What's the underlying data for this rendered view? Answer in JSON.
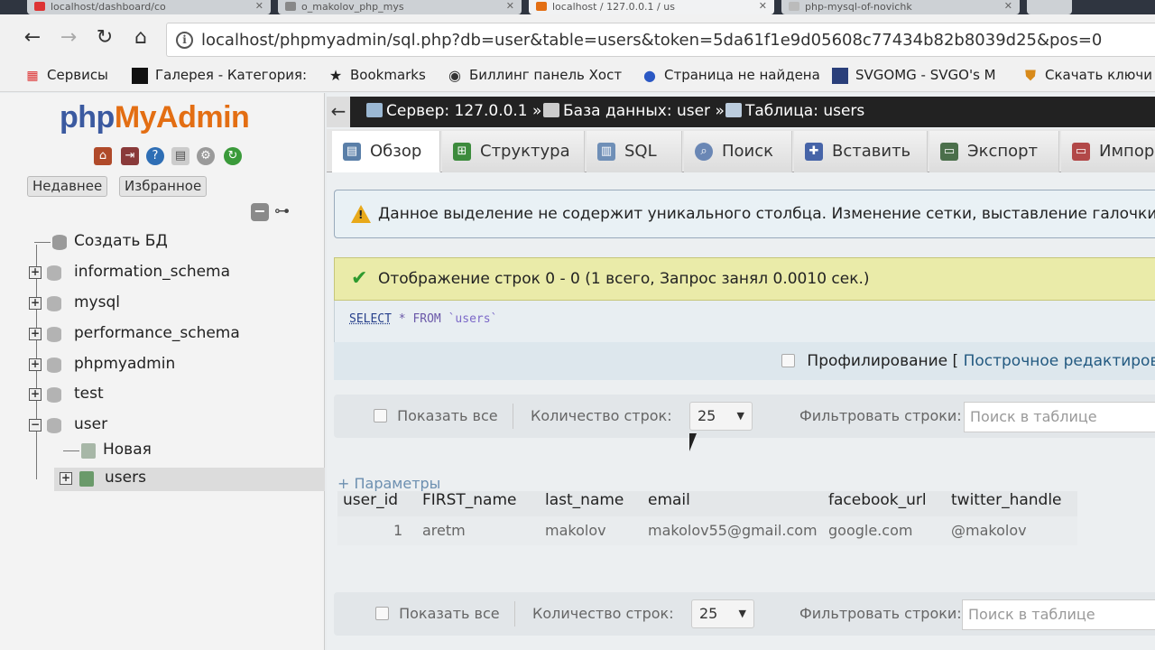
{
  "browser": {
    "tabs": [
      {
        "label": "localhost/dashboard/co",
        "active": false
      },
      {
        "label": "o_makolov_php_mys",
        "active": false
      },
      {
        "label": "localhost / 127.0.0.1 / us",
        "active": true
      },
      {
        "label": "php-mysql-of-novichk",
        "active": false
      }
    ],
    "url": "localhost/phpmyadmin/sql.php?db=user&table=users&token=5da61f1e9d05608c77434b82b8039d25&pos=0",
    "bookmarks": [
      {
        "label": "Сервисы",
        "icon": "apps-grid-icon"
      },
      {
        "label": "Галерея - Категория:",
        "icon": "gallery-icon"
      },
      {
        "label": "Bookmarks",
        "icon": "star-icon"
      },
      {
        "label": "Биллинг панель Хост",
        "icon": "billing-icon"
      },
      {
        "label": "Страница не найдена",
        "icon": "location-pin-icon"
      },
      {
        "label": "SVGOMG - SVGO's M",
        "icon": "svgomg-icon"
      },
      {
        "label": "Скачать ключи д",
        "icon": "shield-icon"
      }
    ]
  },
  "sidebar": {
    "logo": {
      "php": "php",
      "my": "My",
      "admin": "Admin"
    },
    "recent_label": "Недавнее",
    "favorites_label": "Избранное",
    "tree": [
      {
        "label": "Создать БД",
        "type": "new"
      },
      {
        "label": "information_schema",
        "type": "db"
      },
      {
        "label": "mysql",
        "type": "db"
      },
      {
        "label": "performance_schema",
        "type": "db"
      },
      {
        "label": "phpmyadmin",
        "type": "db"
      },
      {
        "label": "test",
        "type": "db"
      },
      {
        "label": "user",
        "type": "db-open"
      },
      {
        "label": "Новая",
        "type": "new-table"
      },
      {
        "label": "users",
        "type": "table"
      }
    ]
  },
  "breadcrumb": {
    "server": "Сервер: 127.0.0.1 »",
    "database": "База данных: user »",
    "table": "Таблица: users"
  },
  "tabs": [
    {
      "label": "Обзор",
      "icon": "browse-icon",
      "color": "#5a7fa8"
    },
    {
      "label": "Структура",
      "icon": "structure-icon",
      "color": "#3d8b3d"
    },
    {
      "label": "SQL",
      "icon": "sql-icon",
      "color": "#6f8fb7"
    },
    {
      "label": "Поиск",
      "icon": "search-icon",
      "color": "#6a87b5"
    },
    {
      "label": "Вставить",
      "icon": "insert-icon",
      "color": "#4664a8"
    },
    {
      "label": "Экспорт",
      "icon": "export-icon",
      "color": "#4b6f4b"
    },
    {
      "label": "Импор",
      "icon": "import-icon",
      "color": "#b24848"
    }
  ],
  "notice": {
    "text": "Данное выделение не содержит уникального столбца. Изменение сетки, выставление галочки, реда"
  },
  "success": {
    "text": "Отображение строк 0 - 0 (1 всего, Запрос занял 0.0010 сек.)"
  },
  "sql": {
    "keyword": "SELECT",
    "rest": " * FROM ",
    "table": "`users`"
  },
  "profiling": {
    "label": "Профилирование [",
    "link": "Построчное редактирован"
  },
  "nav": {
    "show_all": "Показать все",
    "rows_label": "Количество строк:",
    "rows_value": "25",
    "filter_label": "Фильтровать строки:",
    "filter_placeholder": "Поиск в таблице"
  },
  "params_label": "+ Параметры",
  "table": {
    "columns": [
      "user_id",
      "FIRST_name",
      "last_name",
      "email",
      "facebook_url",
      "twitter_handle"
    ],
    "rows": [
      [
        "1",
        "aretm",
        "makolov",
        "makolov55@gmail.com",
        "google.com",
        "@makolov"
      ]
    ]
  }
}
